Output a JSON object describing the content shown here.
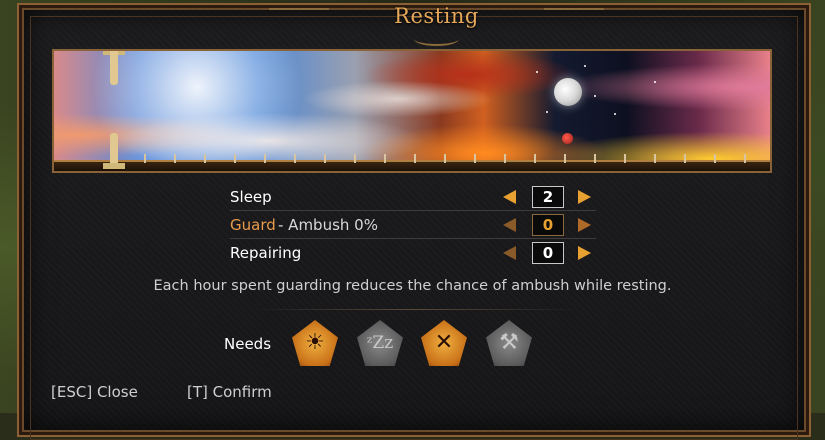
{
  "window": {
    "title": "Resting"
  },
  "rows": [
    {
      "label": "Sleep",
      "sublabel": "",
      "value": "2",
      "highlighted": false
    },
    {
      "label": "Guard",
      "sublabel": "-  Ambush 0%",
      "value": "0",
      "highlighted": true
    },
    {
      "label": "Repairing",
      "sublabel": "",
      "value": "0",
      "highlighted": false
    }
  ],
  "hint": "Each hour spent guarding reduces the chance of ambush while resting.",
  "needs": {
    "label": "Needs",
    "icons": [
      {
        "name": "sun-icon",
        "active": true
      },
      {
        "name": "sleep-icon",
        "active": false
      },
      {
        "name": "food-icon",
        "active": true
      },
      {
        "name": "repair-icon",
        "active": false
      }
    ]
  },
  "footer": {
    "close_hint": "[ESC] Close",
    "confirm_hint": "[T] Confirm"
  },
  "colors": {
    "accent_orange": "#e89a4a",
    "border_bronze": "#8a6238"
  }
}
